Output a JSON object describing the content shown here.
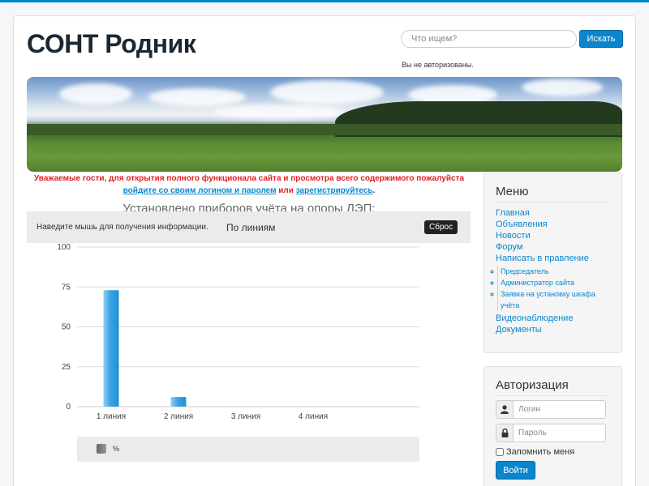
{
  "site": {
    "title": "СОНТ Родник"
  },
  "search": {
    "placeholder": "Что ищем?",
    "button_label": "Искать"
  },
  "auth_status": "Вы не авторизованы.",
  "notice": {
    "text_1": "Уважаемые гости, для открытия полного функционала сайта и просмотра всего содержимого пожалуйста",
    "login_link": "войдите со своим логином и паролем",
    "or": "или",
    "register_link": "зарегистрируйтесь",
    "end": "."
  },
  "chart_section": {
    "title": "Установлено приборов учёта на опоры ЛЭП:",
    "hover_hint": "Наведите мышь для получения информации.",
    "group_label": "По линиям",
    "reset_label": "Сброс",
    "legend_label": "%"
  },
  "chart_data": {
    "type": "bar",
    "title": "",
    "categories": [
      "1 линия",
      "2 линия",
      "3 линия",
      "4 линия"
    ],
    "series": [
      {
        "name": "%",
        "values": [
          73,
          6,
          0,
          0
        ]
      }
    ],
    "ylim": [
      0,
      100
    ],
    "yticks": [
      0,
      25,
      50,
      75,
      100
    ],
    "grid": true,
    "colors": {
      "bar": "#2a96dc",
      "bar_light": "#65b9ee"
    }
  },
  "menu": {
    "title": "Меню",
    "items": [
      {
        "label": "Главная"
      },
      {
        "label": "Объявления"
      },
      {
        "label": "Новости"
      },
      {
        "label": "Форум"
      },
      {
        "label": "Написать в правление"
      }
    ],
    "submenu": [
      {
        "label": "Председатель"
      },
      {
        "label": "Администратор сайта"
      },
      {
        "label": "Заявка на установку шкафа учёта"
      }
    ],
    "items_after": [
      {
        "label": "Видеонаблюдение"
      },
      {
        "label": "Документы"
      }
    ]
  },
  "auth": {
    "title": "Авторизация",
    "login_placeholder": "Логин",
    "password_placeholder": "Пароль",
    "remember_label": "Запомнить меня",
    "login_button": "Войти",
    "user_icon": "user-icon",
    "lock_icon": "lock-icon"
  },
  "colors": {
    "accent": "#0a86cc",
    "notice": "#e02020",
    "title": "#1b2733"
  }
}
